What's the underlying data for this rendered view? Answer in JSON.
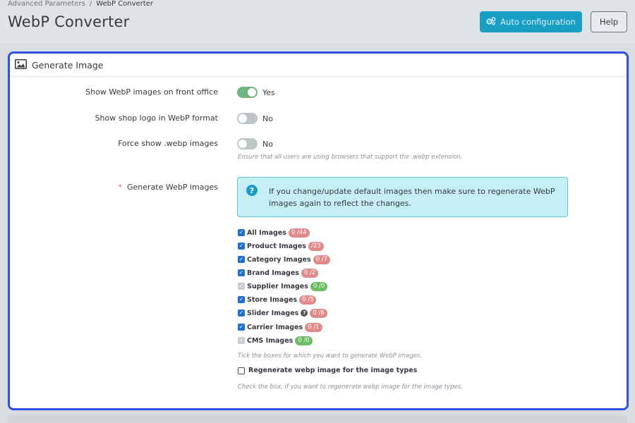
{
  "breadcrumb": {
    "parent": "Advanced Parameters",
    "separator": "/",
    "current": "WebP Converter"
  },
  "page_title": "WebP Converter",
  "toolbar": {
    "auto_config_label": "Auto configuration",
    "auto_config_icon": "gears-icon",
    "help_label": "Help"
  },
  "colors": {
    "accent": "#1a9fc4",
    "panel_border": "#2f4fe0",
    "switch_on": "#70b580",
    "badge_red": "#e08a8a",
    "badge_green": "#6cbd66",
    "alert_bg": "#c5eef5"
  },
  "panel": {
    "title": "Generate Image",
    "icon": "image-icon",
    "fields": {
      "show_front": {
        "label": "Show WebP images on front office",
        "state": "on",
        "state_label": "Yes"
      },
      "show_logo": {
        "label": "Show shop logo in WebP format",
        "state": "off",
        "state_label": "No"
      },
      "force_show": {
        "label": "Force show .webp images",
        "state": "off",
        "state_label": "No",
        "help": "Ensure that all users are using browsers that support the .webp extension."
      },
      "generate": {
        "required_mark": "*",
        "label": "Generate WebP images",
        "alert": "If you change/update default images then make sure to regenerate WebP images again to reflect the changes.",
        "items": [
          {
            "label": "All Images",
            "count": "0 /44",
            "state": "checked",
            "badge_color": "red"
          },
          {
            "label": "Product Images",
            "count": "/23",
            "state": "checked",
            "badge_color": "red"
          },
          {
            "label": "Category Images",
            "count": "0 /7",
            "state": "checked",
            "badge_color": "red"
          },
          {
            "label": "Brand Images",
            "count": "0 /2",
            "state": "checked",
            "badge_color": "red"
          },
          {
            "label": "Supplier Images",
            "count": "0 /0",
            "state": "disabled",
            "badge_color": "green"
          },
          {
            "label": "Store Images",
            "count": "0 /5",
            "state": "checked",
            "badge_color": "red"
          },
          {
            "label": "Slider Images",
            "count": "0 /6",
            "state": "checked",
            "badge_color": "red",
            "hint": "?"
          },
          {
            "label": "Carrier Images",
            "count": "0 /1",
            "state": "checked",
            "badge_color": "red"
          },
          {
            "label": "CMS Images",
            "count": "0 /0",
            "state": "disabled",
            "badge_color": "green"
          }
        ],
        "items_help": "Tick the boxes for which you want to generate WebP images.",
        "regenerate_label": "Regenerate webp image for the image types",
        "regenerate_help": "Check the box, if you want to regenerate webp image for the image types."
      }
    }
  }
}
